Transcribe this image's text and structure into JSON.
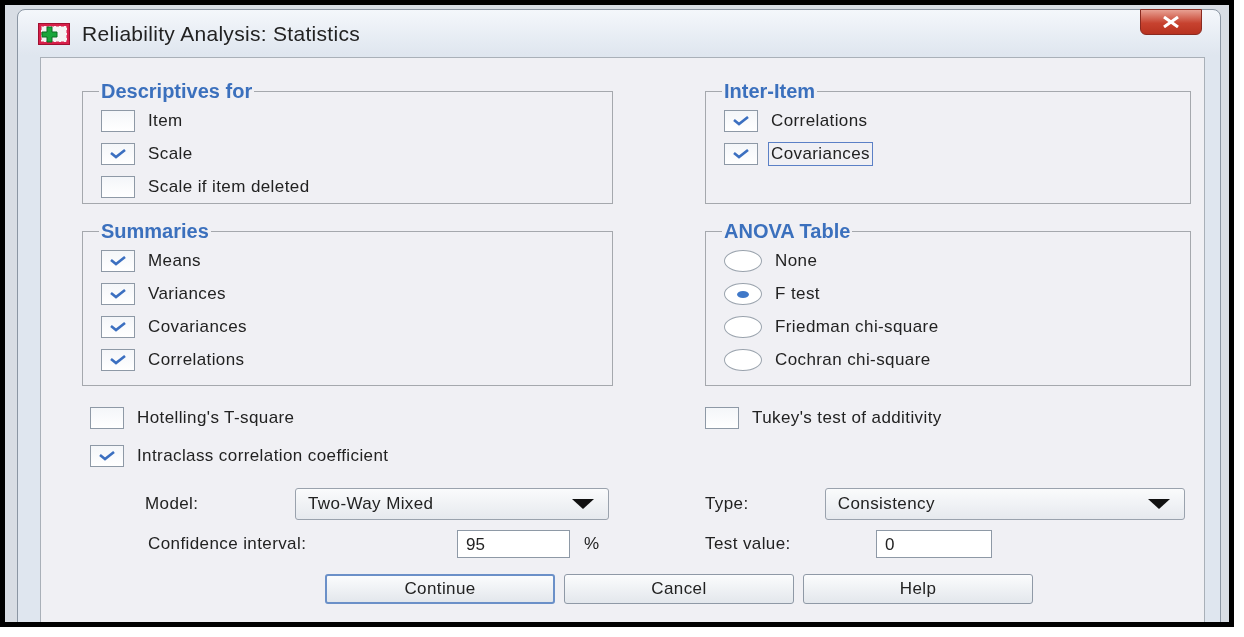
{
  "window": {
    "title": "Reliability Analysis: Statistics"
  },
  "descriptives": {
    "title": "Descriptives for",
    "items": [
      {
        "label": "Item",
        "checked": false
      },
      {
        "label": "Scale",
        "checked": true
      },
      {
        "label": "Scale if item deleted",
        "checked": false
      }
    ]
  },
  "inter_item": {
    "title": "Inter-Item",
    "items": [
      {
        "label": "Correlations",
        "checked": true,
        "focused": false
      },
      {
        "label": "Covariances",
        "checked": true,
        "focused": true
      }
    ]
  },
  "summaries": {
    "title": "Summaries",
    "items": [
      {
        "label": "Means",
        "checked": true
      },
      {
        "label": "Variances",
        "checked": true
      },
      {
        "label": "Covariances",
        "checked": true
      },
      {
        "label": "Correlations",
        "checked": true
      }
    ]
  },
  "anova": {
    "title": "ANOVA Table",
    "options": [
      {
        "label": "None",
        "selected": false
      },
      {
        "label": "F test",
        "selected": true
      },
      {
        "label": "Friedman chi-square",
        "selected": false
      },
      {
        "label": "Cochran chi-square",
        "selected": false
      }
    ]
  },
  "hotelling": {
    "label": "Hotelling's T-square",
    "checked": false
  },
  "tukey": {
    "label": "Tukey's test of additivity",
    "checked": false
  },
  "intraclass": {
    "label": "Intraclass correlation coefficient",
    "checked": true
  },
  "model": {
    "label": "Model:",
    "value": "Two-Way Mixed"
  },
  "type": {
    "label": "Type:",
    "value": "Consistency"
  },
  "confidence": {
    "label": "Confidence interval:",
    "value": "95",
    "unit": "%"
  },
  "test_value": {
    "label": "Test value:",
    "value": "0"
  },
  "buttons": [
    {
      "label": "Continue",
      "default": true
    },
    {
      "label": "Cancel",
      "default": false
    },
    {
      "label": "Help",
      "default": false
    }
  ]
}
